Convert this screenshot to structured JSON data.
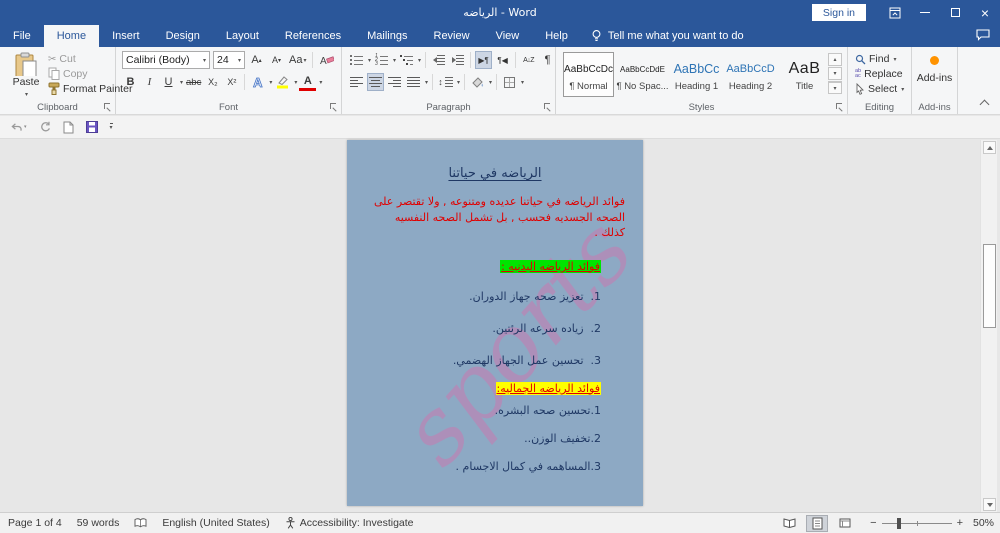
{
  "titlebar": {
    "title": "الرياضه - Word",
    "sign_in": "Sign in"
  },
  "tabs": {
    "items": [
      {
        "label": "File"
      },
      {
        "label": "Home"
      },
      {
        "label": "Insert"
      },
      {
        "label": "Design"
      },
      {
        "label": "Layout"
      },
      {
        "label": "References"
      },
      {
        "label": "Mailings"
      },
      {
        "label": "Review"
      },
      {
        "label": "View"
      },
      {
        "label": "Help"
      }
    ],
    "tell_me": "Tell me what you want to do"
  },
  "ribbon": {
    "clipboard": {
      "label": "Clipboard",
      "paste": "Paste",
      "cut": "Cut",
      "copy": "Copy",
      "format_painter": "Format Painter"
    },
    "font": {
      "label": "Font",
      "font_name": "Calibri (Body)",
      "font_size": "24",
      "bold": "B",
      "italic": "I",
      "underline": "U",
      "strikethrough": "abc",
      "subscript": "X₂",
      "superscript": "X²",
      "grow_font": "A",
      "shrink_font": "A",
      "change_case": "Aa",
      "text_effects": "A",
      "font_color": "A"
    },
    "paragraph": {
      "label": "Paragraph",
      "sort": "A↓Z",
      "pilcrow": "¶",
      "dir_rtl": "▶¶",
      "dir_ltr": "¶◀"
    },
    "styles": {
      "label": "Styles",
      "items": [
        {
          "sample": "AaBbCcDc",
          "name": "¶ Normal"
        },
        {
          "sample": "AaBbCcDdE",
          "name": "¶ No Spac..."
        },
        {
          "sample": "AaBbCc",
          "name": "Heading 1"
        },
        {
          "sample": "AaBbCcD",
          "name": "Heading 2"
        },
        {
          "sample": "AaB",
          "name": "Title"
        }
      ]
    },
    "editing": {
      "label": "Editing",
      "find": "Find",
      "replace": "Replace",
      "select": "Select"
    },
    "addins": {
      "label": "Add-ins",
      "button": "Add-ins"
    }
  },
  "document": {
    "title": "الرياضه في حياتنا",
    "intro": "فوائد الرياضه في حياتنا عديده ومتنوعه , ولا تقتصر على الصحه الجسديه فحسب , بل تشمل الصحه النفسيه كذلك .",
    "heading_physical": "فوائد الرياضه البدنيه :",
    "physical_items": [
      "1.  تعزيز صحه جهاز الدوران.",
      "2.  زياده سرعه الرئتين.",
      "3.  تحسين عمل الجهاز الهضمي."
    ],
    "heading_beauty": "فوائد الرياضه الجماليه:",
    "beauty_items": [
      "1.تحسين صحه البشره.",
      "2.تخفيف الوزن..",
      "3.المساهمه في كمال الاجسام ."
    ],
    "watermark": "sports"
  },
  "statusbar": {
    "page": "Page 1 of 4",
    "words": "59 words",
    "language": "English (United States)",
    "accessibility": "Accessibility: Investigate",
    "zoom_out": "−",
    "zoom_in": "+",
    "zoom_level": "50%"
  },
  "colors": {
    "titlebar": "#2b579a",
    "page_bg": "#8da9c4",
    "doc_text": "#1f3864",
    "red_text": "#e00000",
    "highlight_green": "#00e400",
    "highlight_yellow": "#ffff00",
    "watermark_pink": "#d173ae",
    "addins_dot": "#ff9300"
  }
}
